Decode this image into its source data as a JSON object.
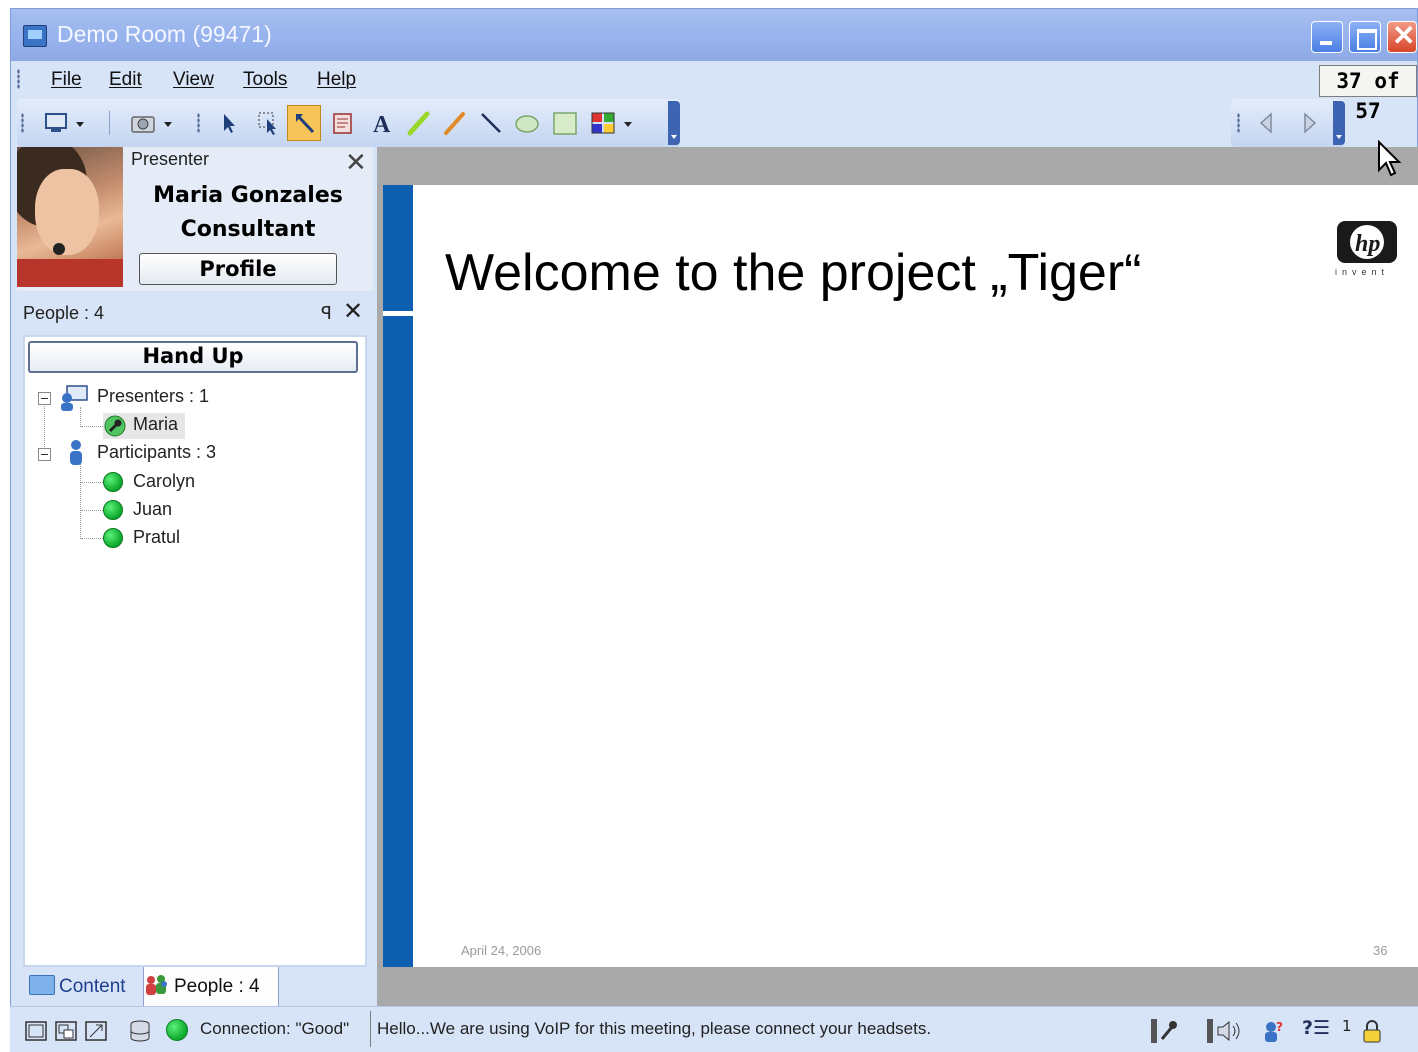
{
  "window": {
    "title": "Demo Room (99471)",
    "accent": "#8eaae6"
  },
  "menu": {
    "items": [
      "File",
      "Edit",
      "View",
      "Tools",
      "Help"
    ]
  },
  "page_counter": "37 of 57",
  "toolbar": {
    "icons": [
      "screen-share-icon",
      "camera-icon",
      "pointer-icon",
      "select-icon",
      "laser-pointer-icon",
      "clear-annotations-icon",
      "text-tool-icon",
      "highlighter-icon",
      "pen-icon",
      "line-icon",
      "ellipse-icon",
      "rectangle-icon",
      "color-picker-icon"
    ],
    "nav_icons": [
      "previous-slide-icon",
      "next-slide-icon"
    ]
  },
  "presenter": {
    "label": "Presenter",
    "name": "Maria Gonzales",
    "title": "Consultant",
    "profile_button": "Profile"
  },
  "people": {
    "header": "People : 4",
    "hand_up_button": "Hand Up",
    "groups": [
      {
        "label": "Presenters : 1",
        "members": [
          "Maria"
        ]
      },
      {
        "label": "Participants : 3",
        "members": [
          "Carolyn",
          "Juan",
          "Pratul"
        ]
      }
    ]
  },
  "tabs": {
    "content": "Content",
    "people": "People : 4"
  },
  "slide": {
    "title": "Welcome to the project „Tiger“",
    "date": "April 24, 2006",
    "page_number": "36",
    "logo_text": "invent",
    "bar_color": "#0d5fb0"
  },
  "status": {
    "connection": "Connection: \"Good\"",
    "message": "Hello...We are using VoIP for this meeting, please connect your headsets.",
    "help_label": "?☰",
    "count": "1"
  }
}
